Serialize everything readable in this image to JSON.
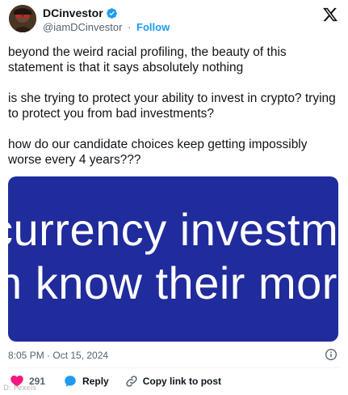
{
  "author": {
    "display_name": "DCinvestor",
    "handle": "@iamDCinvestor",
    "separator": "·",
    "follow_label": "Follow"
  },
  "tweet": {
    "paragraphs": [
      "beyond the weird racial profiling, the beauty of this statement is that it says absolutely nothing",
      "is she trying to protect your ability to invest in crypto? trying to protect you from bad investments?",
      "how do our candidate choices keep getting impossibly worse every 4 years???"
    ]
  },
  "media": {
    "line1": "currency investm",
    "line2": "n know their mor",
    "background_color": "#202b9c"
  },
  "meta": {
    "timestamp": "8:05 PM · Oct 15, 2024"
  },
  "actions": {
    "like_count": "291",
    "reply_label": "Reply",
    "copy_label": "Copy link to post"
  },
  "watermark": "D: Pexels",
  "colors": {
    "accent": "#1d9bf0",
    "like": "#f91880",
    "text": "#0f1419",
    "muted": "#536471"
  }
}
